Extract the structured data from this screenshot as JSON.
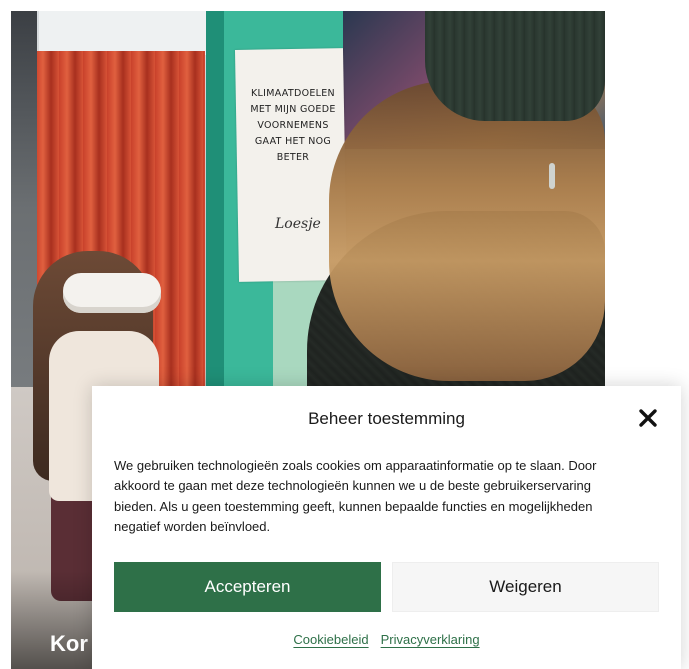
{
  "background": {
    "poster_lines": [
      "KLIMAATDOELEN",
      "MET MIJN GOEDE",
      "VOORNEMENS",
      "GAAT HET NOG",
      "BETER"
    ],
    "poster_signature": "Loesje",
    "title_fragment": "Kor"
  },
  "consent": {
    "title": "Beheer toestemming",
    "close_icon": "close-icon",
    "body": "We gebruiken technologieën zoals cookies om apparaatinformatie op te slaan. Door akkoord te gaan met deze technologieën kunnen we u de beste gebruikerservaring bieden. Als u geen toestemming geeft, kunnen bepaalde functies en mogelijkheden negatief worden beïnvloed.",
    "accept_label": "Accepteren",
    "deny_label": "Weigeren",
    "links": {
      "cookie_policy": "Cookiebeleid",
      "privacy_statement": "Privacyverklaring"
    },
    "colors": {
      "accent": "#2e7048",
      "deny_bg": "#f6f6f6"
    }
  }
}
